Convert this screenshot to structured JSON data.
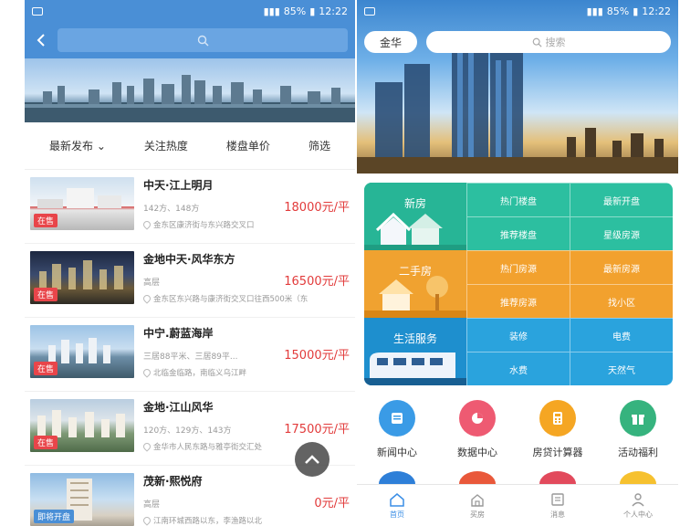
{
  "left_screen": {
    "status_bar": {
      "battery": "85%",
      "time": "12:22"
    },
    "filters": [
      "最新发布",
      "关注热度",
      "楼盘单价",
      "筛选"
    ],
    "listings": [
      {
        "name": "中天·江上明月",
        "meta": "142方、148方",
        "price": "18000元/平",
        "address": "金东区康济街与东兴路交叉口",
        "tag": "在售"
      },
      {
        "name": "金地中天·风华东方",
        "meta": "高层",
        "price": "16500元/平",
        "address": "金东区东兴路与康济街交叉口往西500米（东",
        "tag": "在售"
      },
      {
        "name": "中宁.蔚蓝海岸",
        "meta": "三居88平米、三居89平...",
        "price": "15000元/平",
        "address": "北临金临路，南临义乌江畔",
        "tag": "在售"
      },
      {
        "name": "金地·江山风华",
        "meta": "120方、129方、143方",
        "price": "17500元/平",
        "address": "金华市人民东路与雅亭街交汇处",
        "tag": "在售"
      },
      {
        "name": "茂新·熙悦府",
        "meta": "高层",
        "price": "0元/平",
        "address": "江南环城西路以东，李渔路以北",
        "tag": "即将开盘"
      }
    ]
  },
  "right_screen": {
    "status_bar": {
      "battery": "85%",
      "time": "12:22"
    },
    "city": "金华",
    "search_placeholder": "搜索",
    "sections": [
      {
        "title": "新房",
        "cells": [
          "热门楼盘",
          "最新开盘",
          "推荐楼盘",
          "星级房源"
        ]
      },
      {
        "title": "二手房",
        "cells": [
          "热门房源",
          "最新房源",
          "推荐房源",
          "找小区"
        ]
      },
      {
        "title": "生活服务",
        "cells": [
          "装修",
          "电费",
          "水费",
          "天然气"
        ]
      }
    ],
    "quick_actions": [
      {
        "label": "新闻中心",
        "icon": "news-icon"
      },
      {
        "label": "数据中心",
        "icon": "data-icon"
      },
      {
        "label": "房贷计算器",
        "icon": "calculator-icon"
      },
      {
        "label": "活动福利",
        "icon": "gift-icon"
      }
    ],
    "tabbar": [
      "首页",
      "买房",
      "消息",
      "个人中心"
    ],
    "colors": {
      "new": "#2cbfa0",
      "used": "#f2a12e",
      "life": "#2aa3dd",
      "price": "#e23b3b",
      "header": "#4a8fd6"
    }
  }
}
